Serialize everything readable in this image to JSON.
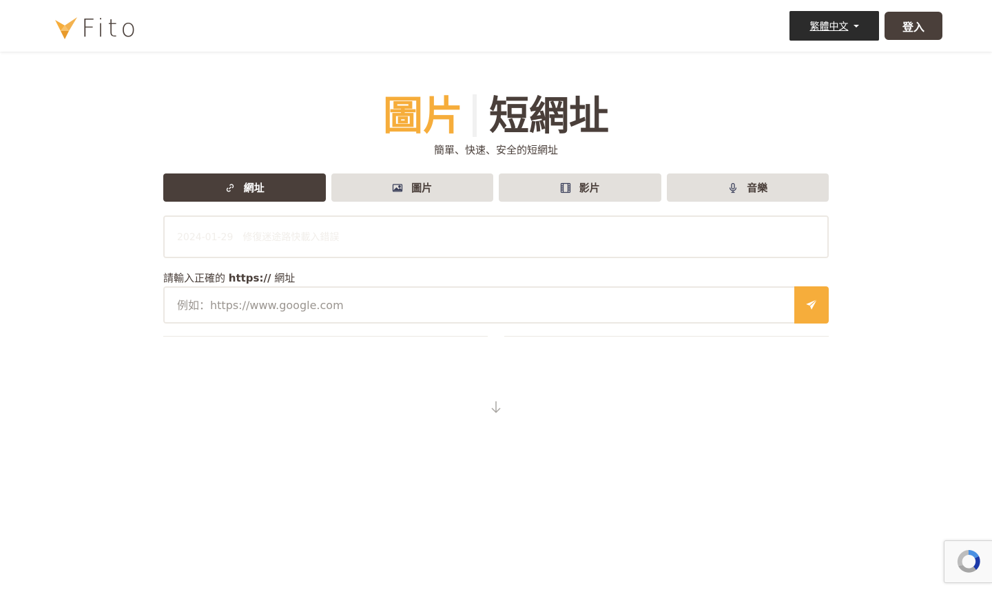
{
  "header": {
    "logo_text": "Fito",
    "language_label": "繁體中文",
    "login_label": "登入"
  },
  "hero": {
    "title_accent": "圖片",
    "title_main": "短網址",
    "subtitle": "簡單、快速、安全的短網址"
  },
  "tabs": [
    {
      "label": "網址",
      "icon": "link-icon",
      "active": true
    },
    {
      "label": "圖片",
      "icon": "image-icon",
      "active": false
    },
    {
      "label": "影片",
      "icon": "film-icon",
      "active": false
    },
    {
      "label": "音樂",
      "icon": "microphone-icon",
      "active": false
    }
  ],
  "notice": {
    "text": "2024-01-29　修復迷途路快載入錯誤"
  },
  "url_form": {
    "label_prefix": "請輸入正確的 ",
    "label_bold": "https://",
    "label_suffix": " 網址",
    "placeholder": "例如：https://www.google.com",
    "value": ""
  },
  "colors": {
    "accent": "#f6ad3b",
    "brand_dark": "#4a3f3a",
    "lang_button": "#2b2b2b",
    "tab_inactive": "#e3e0dc"
  }
}
